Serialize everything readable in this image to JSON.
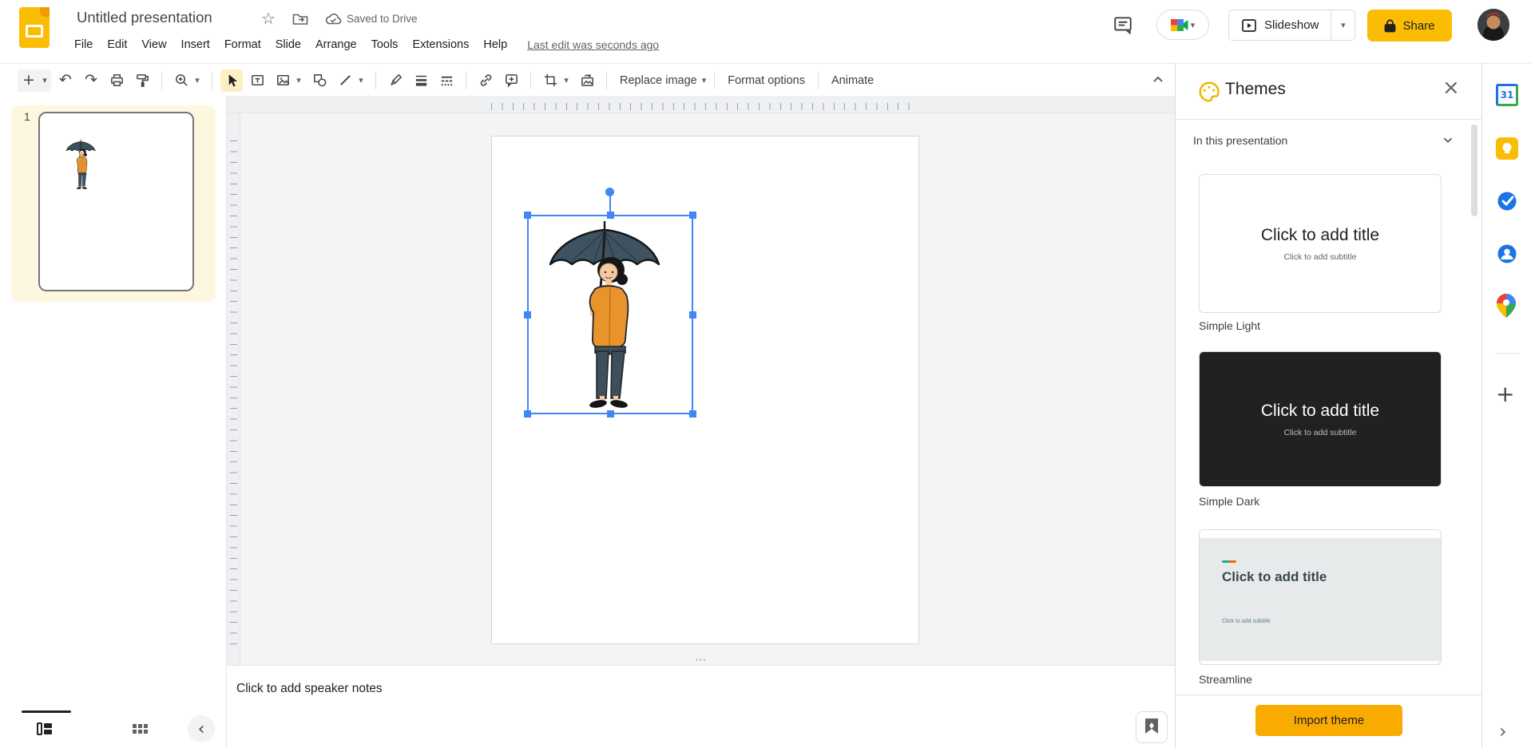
{
  "colors": {
    "accent_blue": "#4285f4",
    "share_yellow": "#fbbc04",
    "import_yellow": "#f9ab00",
    "active_tool_bg": "#feefc3",
    "logo_yellow": "#fbbc04",
    "selection_highlight": "#fef7e0"
  },
  "header": {
    "title": "Untitled presentation",
    "saved_status": "Saved to Drive",
    "menus": [
      "File",
      "Edit",
      "View",
      "Insert",
      "Format",
      "Slide",
      "Arrange",
      "Tools",
      "Extensions",
      "Help"
    ],
    "last_edit": "Last edit was seconds ago",
    "slideshow_label": "Slideshow",
    "share_label": "Share"
  },
  "toolbar": {
    "replace_image_label": "Replace image",
    "format_options_label": "Format options",
    "animate_label": "Animate"
  },
  "filmstrip": {
    "slide_number": "1"
  },
  "notes": {
    "placeholder": "Click to add speaker notes"
  },
  "themes_panel": {
    "title": "Themes",
    "section_label": "In this presentation",
    "import_button_label": "Import theme",
    "themes": [
      {
        "name": "Simple Light",
        "title": "Click to add title",
        "subtitle": "Click to add subtitle"
      },
      {
        "name": "Simple Dark",
        "title": "Click to add title",
        "subtitle": "Click to add subtitle"
      },
      {
        "name": "Streamline",
        "title": "Click to add title",
        "subtitle": "Click to add subtitle"
      }
    ]
  },
  "glyphs": {
    "star": "☆",
    "caret_down": "▾",
    "undo": "↶",
    "redo": "↷",
    "plus": "+",
    "overflow_dots": "⋯",
    "close": "×",
    "chevron_left": "‹",
    "chevron_right": "›",
    "calendar_day": "31"
  }
}
